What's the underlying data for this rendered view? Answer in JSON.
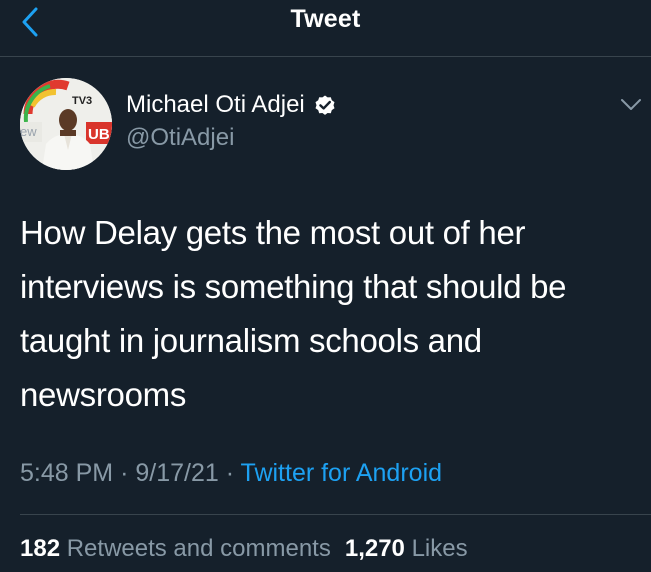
{
  "header": {
    "title": "Tweet",
    "back_icon": "chevron-left-icon",
    "accent_color": "#1da1f2"
  },
  "author": {
    "name": "Michael Oti Adjei",
    "handle": "@OtiAdjei",
    "verified": true,
    "avatar_logo_text": "TV3",
    "avatar_backdrop_text_left": "ew",
    "avatar_backdrop_text_right": "UB"
  },
  "tweet": {
    "lines": [
      "How Delay gets the most out of her",
      "interviews is something that should be",
      "taught in journalism schools and",
      "newsrooms"
    ]
  },
  "meta": {
    "time": "5:48 PM",
    "separator": "·",
    "date": "9/17/21",
    "source": "Twitter for Android"
  },
  "stats": {
    "retweets_count": "182",
    "retweets_label": "Retweets and comments",
    "likes_count": "1,270",
    "likes_label": "Likes"
  },
  "colors": {
    "background": "#15202b",
    "secondary_text": "#8899a6",
    "divider": "#38444d",
    "link": "#1da1f2"
  }
}
